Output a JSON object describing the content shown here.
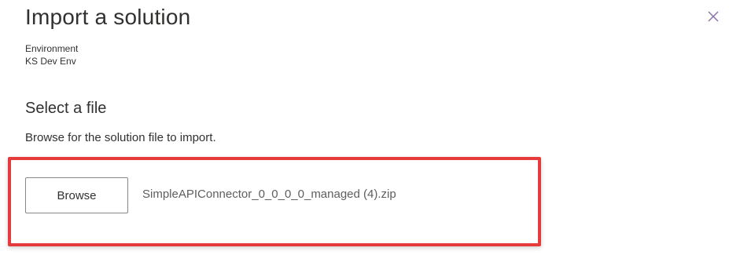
{
  "dialog": {
    "title": "Import a solution",
    "close_icon": "close-icon",
    "close_color": "#8a6fa8"
  },
  "environment": {
    "label": "Environment",
    "value": "KS Dev Env"
  },
  "file_section": {
    "heading": "Select a file",
    "description": "Browse for the solution file to import.",
    "browse_label": "Browse",
    "selected_file": "SimpleAPIConnector_0_0_0_0_managed (4).zip",
    "highlight_color": "#e63b3b"
  }
}
